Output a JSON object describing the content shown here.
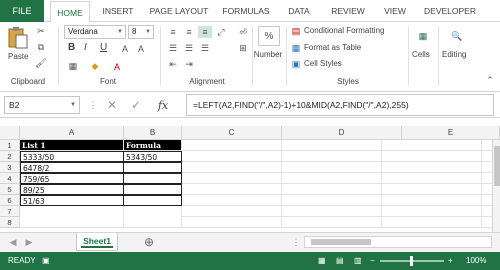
{
  "ribbon_tabs": {
    "file": "FILE",
    "home": "HOME",
    "insert": "INSERT",
    "page_layout": "PAGE LAYOUT",
    "formulas": "FORMULAS",
    "data": "DATA",
    "review": "REVIEW",
    "view": "VIEW",
    "developer": "DEVELOPER"
  },
  "clipboard": {
    "paste_label": "Paste",
    "group_label": "Clipboard"
  },
  "font": {
    "name": "Verdana",
    "size": "8",
    "group_label": "Font",
    "bold": "B",
    "italic": "I",
    "underline": "U"
  },
  "alignment": {
    "group_label": "Alignment"
  },
  "number": {
    "label": "Number",
    "percent": "%"
  },
  "styles": {
    "conditional_formatting": "Conditional Formatting",
    "format_as_table": "Format as Table",
    "cell_styles": "Cell Styles",
    "group_label": "Styles"
  },
  "cells": {
    "label": "Cells"
  },
  "editing": {
    "label": "Editing"
  },
  "formula_bar": {
    "name_box": "B2",
    "fx": "fx",
    "formula": "=LEFT(A2,FIND(\"/\",A2)-1)+10&MID(A2,FIND(\"/\",A2),255)"
  },
  "grid": {
    "columns": [
      "A",
      "B",
      "C",
      "D",
      "E"
    ],
    "rows": [
      "1",
      "2",
      "3",
      "4",
      "5",
      "6",
      "7",
      "8"
    ],
    "cells": {
      "A1": "List 1",
      "B1": "Formula",
      "A2": "5333/50",
      "B2": "5343/50",
      "A3": "6478/2",
      "A4": "759/65",
      "A5": "89/25",
      "A6": "51/63"
    }
  },
  "sheet_tabs": {
    "active": "Sheet1",
    "add": "⊕"
  },
  "status_bar": {
    "ready": "READY",
    "zoom": "100%",
    "zoom_minus": "−",
    "zoom_plus": "+"
  },
  "colors": {
    "accent": "#217346",
    "header_fill": "#000000"
  }
}
